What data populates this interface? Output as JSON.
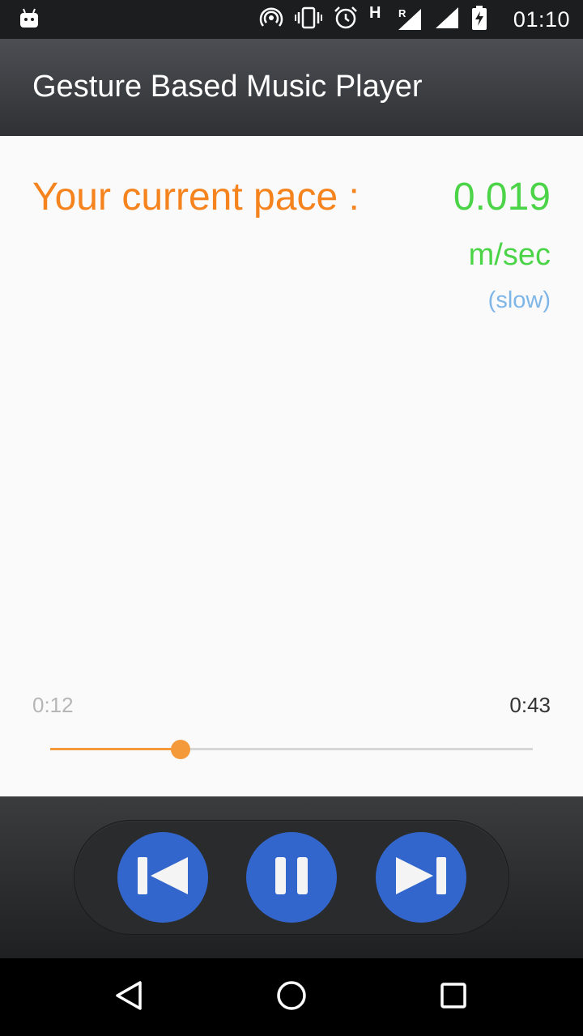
{
  "status_bar": {
    "time": "01:10",
    "network_label": "H",
    "roaming_label": "R",
    "icons": [
      "android-icon",
      "hotspot-icon",
      "vibrate-icon",
      "alarm-icon",
      "signal-icon",
      "signal-icon",
      "battery-charging-icon"
    ]
  },
  "app_bar": {
    "title": "Gesture Based Music Player"
  },
  "pace": {
    "label": "Your current pace :",
    "value": "0.019",
    "unit": "m/sec",
    "category": "(slow)"
  },
  "playback": {
    "elapsed": "0:12",
    "total": "0:43",
    "progress_fraction": 0.27
  },
  "controls": {
    "buttons": [
      "previous-icon",
      "pause-icon",
      "next-icon"
    ]
  },
  "nav_bar": {
    "buttons": [
      "back-icon",
      "home-icon",
      "recents-icon"
    ]
  },
  "colors": {
    "accent_orange": "#f5841f",
    "pace_green": "#4cd449",
    "category_blue": "#7fb6e8",
    "control_blue": "#3266cc"
  }
}
